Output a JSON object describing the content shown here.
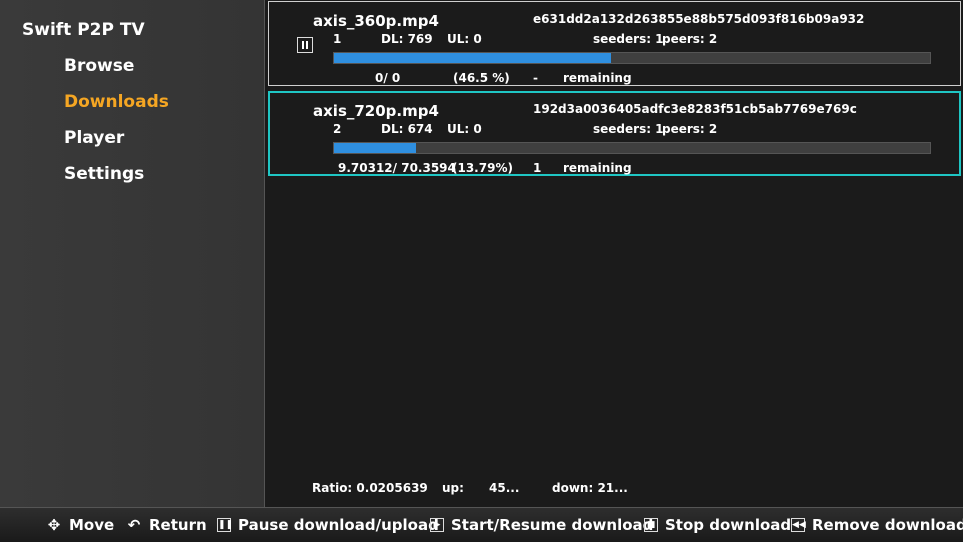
{
  "app": {
    "title": "Swift P2P TV"
  },
  "nav": [
    {
      "label": "Browse",
      "active": false
    },
    {
      "label": "Downloads",
      "active": true
    },
    {
      "label": "Player",
      "active": false
    },
    {
      "label": "Settings",
      "active": false
    }
  ],
  "downloads": [
    {
      "filename": "axis_360p.mp4",
      "hash": "e631dd2a132d263855e88b575d093f816b09a932",
      "index": "1",
      "dl": "DL: 769",
      "ul": "UL: 0",
      "seeders": "seeders: 1",
      "peers": "peers:  2",
      "progress_fraction": 0.465,
      "size": "0/ 0",
      "percent": "(46.5 %)",
      "eta": "-",
      "remaining": "remaining",
      "paused": true
    },
    {
      "filename": "axis_720p.mp4",
      "hash": "192d3a0036405adfc3e8283f51cb5ab7769e769c",
      "index": "2",
      "dl": "DL: 674",
      "ul": "UL: 0",
      "seeders": "seeders: 1",
      "peers": "peers:  2",
      "progress_fraction": 0.1379,
      "size": "9.70312/ 70.3594",
      "percent": "(13.79%)",
      "eta": "1",
      "remaining": "remaining",
      "selected": true
    }
  ],
  "stats": {
    "ratio": "Ratio: 0.0205639",
    "up": "up:      45...",
    "down": "down: 21..."
  },
  "footer": {
    "move": "Move",
    "return": "Return",
    "pause": "Pause download/upload",
    "start": "Start/Resume download",
    "stop": "Stop download",
    "remove": "Remove download"
  },
  "colors": {
    "accent": "#f5a623",
    "selection": "#1fc6c4",
    "progress": "#2f8fe0"
  }
}
